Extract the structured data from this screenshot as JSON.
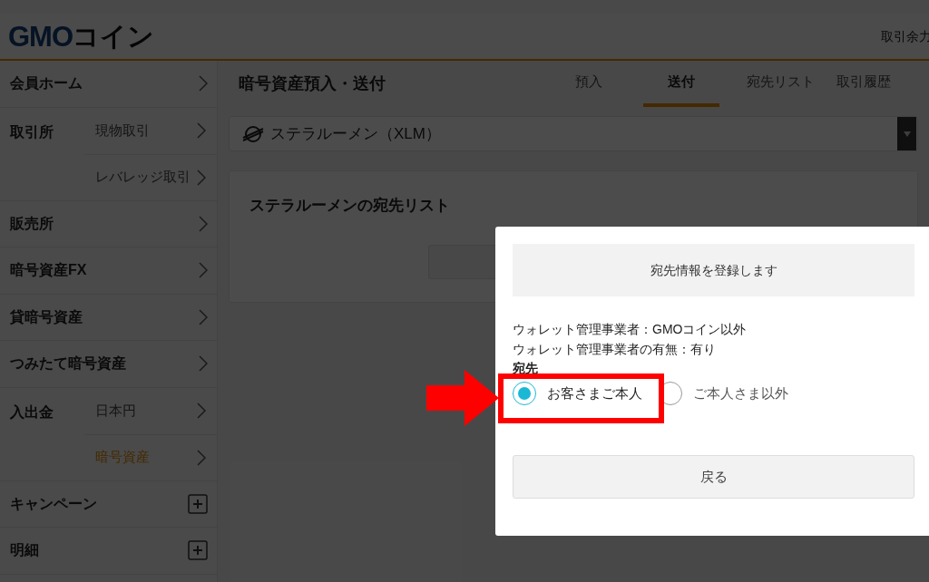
{
  "header": {
    "logo_latin": "GMO",
    "logo_kana": "コイン",
    "right_text": "取引余力"
  },
  "sidebar": {
    "items": [
      {
        "kind": "link",
        "label": "会員ホーム"
      },
      {
        "kind": "group",
        "label": "取引所",
        "children": [
          {
            "label": "現物取引",
            "selected": false
          },
          {
            "label": "レバレッジ取引",
            "selected": false
          }
        ]
      },
      {
        "kind": "link",
        "label": "販売所"
      },
      {
        "kind": "link",
        "label": "暗号資産FX"
      },
      {
        "kind": "link",
        "label": "貸暗号資産"
      },
      {
        "kind": "link",
        "label": "つみたて暗号資産"
      },
      {
        "kind": "group",
        "label": "入出金",
        "children": [
          {
            "label": "日本円",
            "selected": false
          },
          {
            "label": "暗号資産",
            "selected": true
          }
        ]
      },
      {
        "kind": "expand",
        "label": "キャンペーン"
      },
      {
        "kind": "expand",
        "label": "明細"
      }
    ]
  },
  "main": {
    "title": "暗号資産預入・送付",
    "tabs": [
      {
        "label": "預入",
        "selected": false
      },
      {
        "label": "送付",
        "selected": true
      },
      {
        "label": "宛先リスト",
        "selected": false
      },
      {
        "label": "取引履歴",
        "selected": false
      }
    ],
    "currency_select": {
      "value": "ステラルーメン（XLM）"
    },
    "card": {
      "title": "ステラルーメンの宛先リスト"
    }
  },
  "modal": {
    "header": "宛先情報を登録します",
    "lines": [
      "ウォレット管理事業者：GMOコイン以外",
      "ウォレット管理事業者の有無：有り"
    ],
    "field_label": "宛先",
    "options": [
      {
        "label": "お客さまご本人",
        "selected": true
      },
      {
        "label": "ご本人さま以外",
        "selected": false
      }
    ],
    "back_button": "戻る"
  }
}
